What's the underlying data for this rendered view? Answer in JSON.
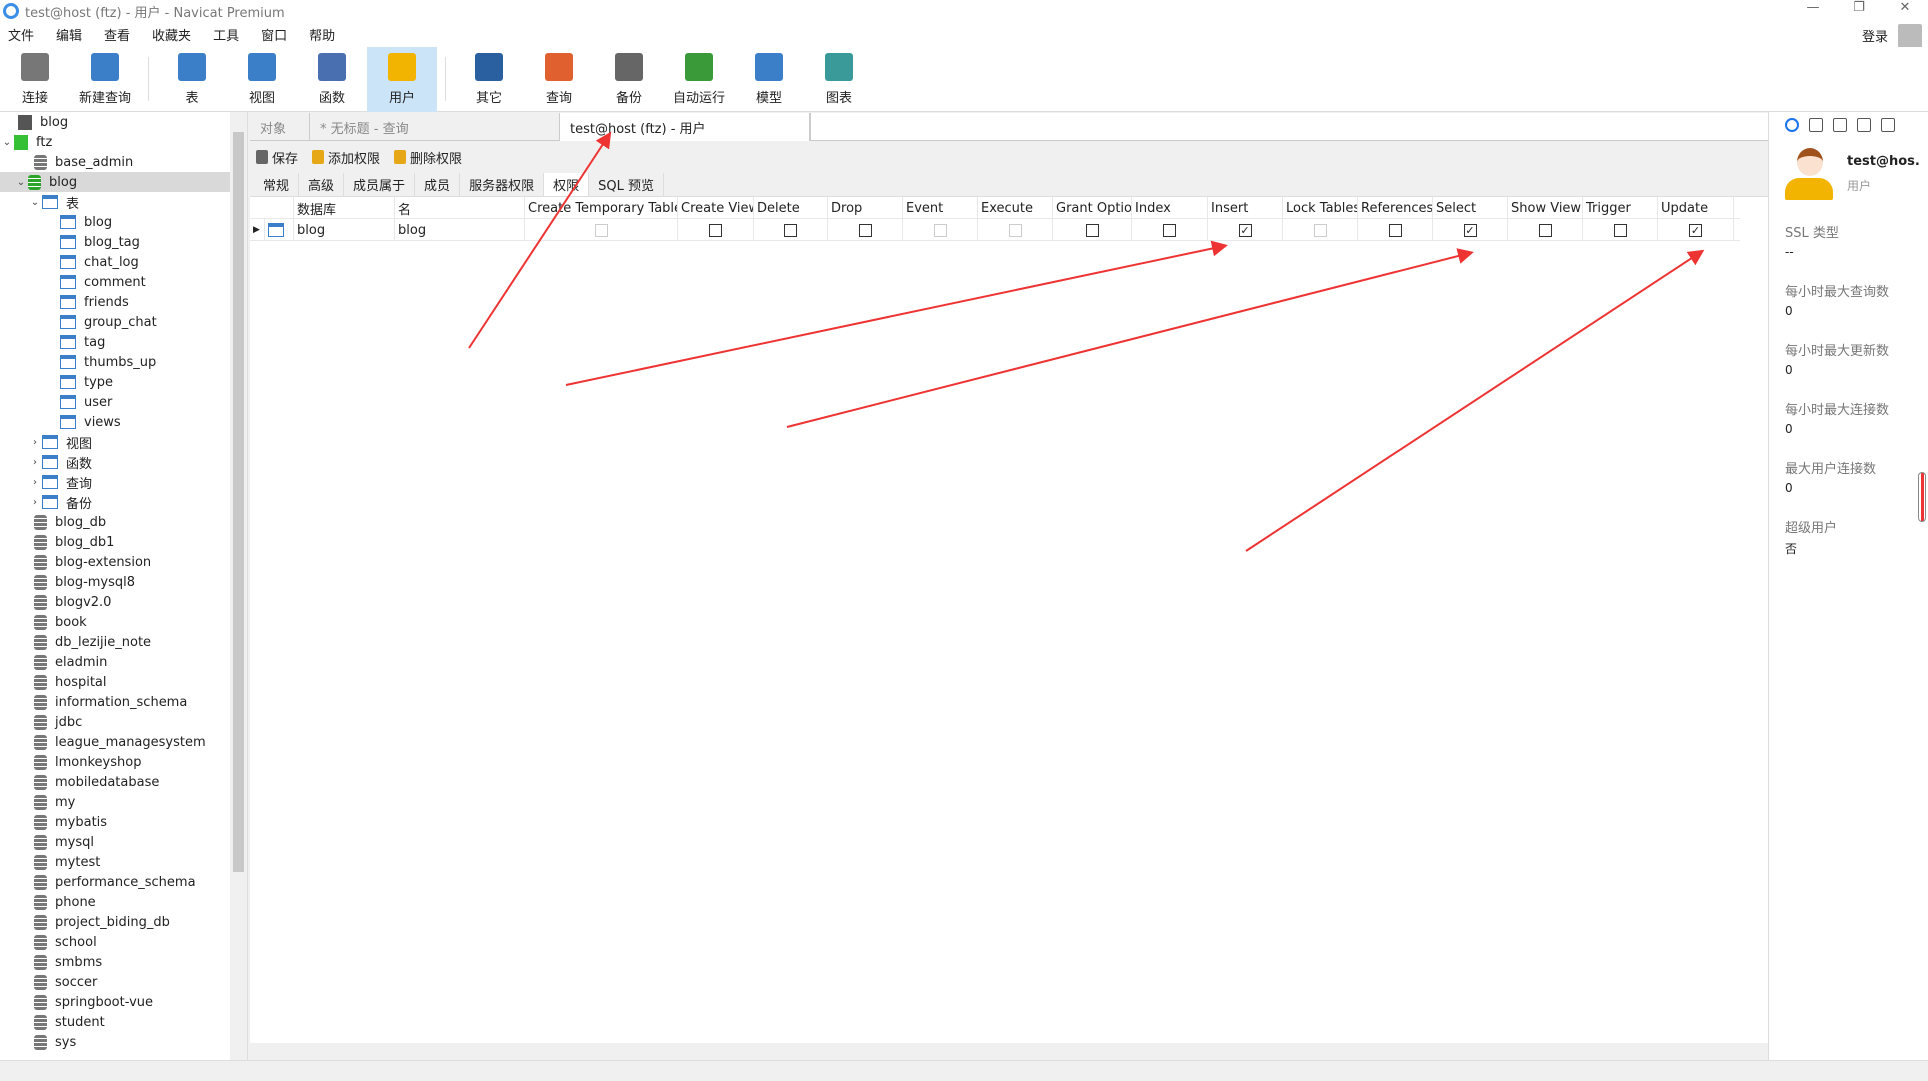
{
  "window": {
    "title": "test@host (ftz) - 用户 - Navicat Premium",
    "controls": [
      "—",
      "❐",
      "✕"
    ]
  },
  "menu": [
    "文件",
    "编辑",
    "查看",
    "收藏夹",
    "工具",
    "窗口",
    "帮助"
  ],
  "login": "登录",
  "toolbar": [
    {
      "label": "连接",
      "icon": "connect-icon"
    },
    {
      "label": "新建查询",
      "icon": "new-query-icon"
    },
    {
      "label": "表",
      "icon": "table-icon"
    },
    {
      "label": "视图",
      "icon": "view-icon"
    },
    {
      "label": "函数",
      "icon": "function-icon"
    },
    {
      "label": "用户",
      "icon": "user-icon",
      "active": true
    },
    {
      "label": "其它",
      "icon": "tools-icon"
    },
    {
      "label": "查询",
      "icon": "query-icon"
    },
    {
      "label": "备份",
      "icon": "backup-icon"
    },
    {
      "label": "自动运行",
      "icon": "schedule-icon"
    },
    {
      "label": "模型",
      "icon": "model-icon"
    },
    {
      "label": "图表",
      "icon": "chart-icon"
    }
  ],
  "sidebar": {
    "connections": [
      {
        "name": "blog"
      },
      {
        "name": "ftz",
        "expanded": true
      }
    ],
    "ftz_dbs_before": [
      "base_admin"
    ],
    "selected_db": "blog",
    "tables_group": "表",
    "tables": [
      "blog",
      "blog_tag",
      "chat_log",
      "comment",
      "friends",
      "group_chat",
      "tag",
      "thumbs_up",
      "type",
      "user",
      "views"
    ],
    "groups": [
      "视图",
      "函数",
      "查询",
      "备份"
    ],
    "dbs_after": [
      "blog_db",
      "blog_db1",
      "blog-extension",
      "blog-mysql8",
      "blogv2.0",
      "book",
      "db_lezijie_note",
      "eladmin",
      "hospital",
      "information_schema",
      "jdbc",
      "league_managesystem",
      "lmonkeyshop",
      "mobiledatabase",
      "my",
      "mybatis",
      "mysql",
      "mytest",
      "performance_schema",
      "phone",
      "project_biding_db",
      "school",
      "smbms",
      "soccer",
      "springboot-vue",
      "student",
      "sys"
    ]
  },
  "tabs": [
    {
      "label": "对象"
    },
    {
      "label": "* 无标题 - 查询"
    },
    {
      "label": "test@host (ftz) - 用户",
      "active": true
    }
  ],
  "actions": {
    "save": "保存",
    "add": "添加权限",
    "remove": "删除权限"
  },
  "subtabs": [
    "常规",
    "高级",
    "成员属于",
    "成员",
    "服务器权限",
    "权限",
    "SQL 预览"
  ],
  "active_subtab": "权限",
  "grid": {
    "headers": [
      "数据库",
      "名",
      "Create Temporary Tables",
      "Create View",
      "Delete",
      "Drop",
      "Event",
      "Execute",
      "Grant Option",
      "Index",
      "Insert",
      "Lock Tables",
      "References",
      "Select",
      "Show View",
      "Trigger",
      "Update"
    ],
    "rows": [
      {
        "database": "blog",
        "name": "blog",
        "privs": [
          null,
          false,
          false,
          false,
          null,
          null,
          false,
          false,
          true,
          null,
          false,
          true,
          false,
          false,
          true
        ]
      }
    ]
  },
  "info": {
    "user": "test@hos.",
    "role": "用户",
    "props": [
      {
        "label": "SSL 类型",
        "value": "--"
      },
      {
        "label": "每小时最大查询数",
        "value": "0"
      },
      {
        "label": "每小时最大更新数",
        "value": "0"
      },
      {
        "label": "每小时最大连接数",
        "value": "0"
      },
      {
        "label": "最大用户连接数",
        "value": "0"
      },
      {
        "label": "超级用户",
        "value": "否"
      }
    ]
  },
  "colors": {
    "accent": "#cce4f7",
    "annotation": "#ee3333"
  }
}
